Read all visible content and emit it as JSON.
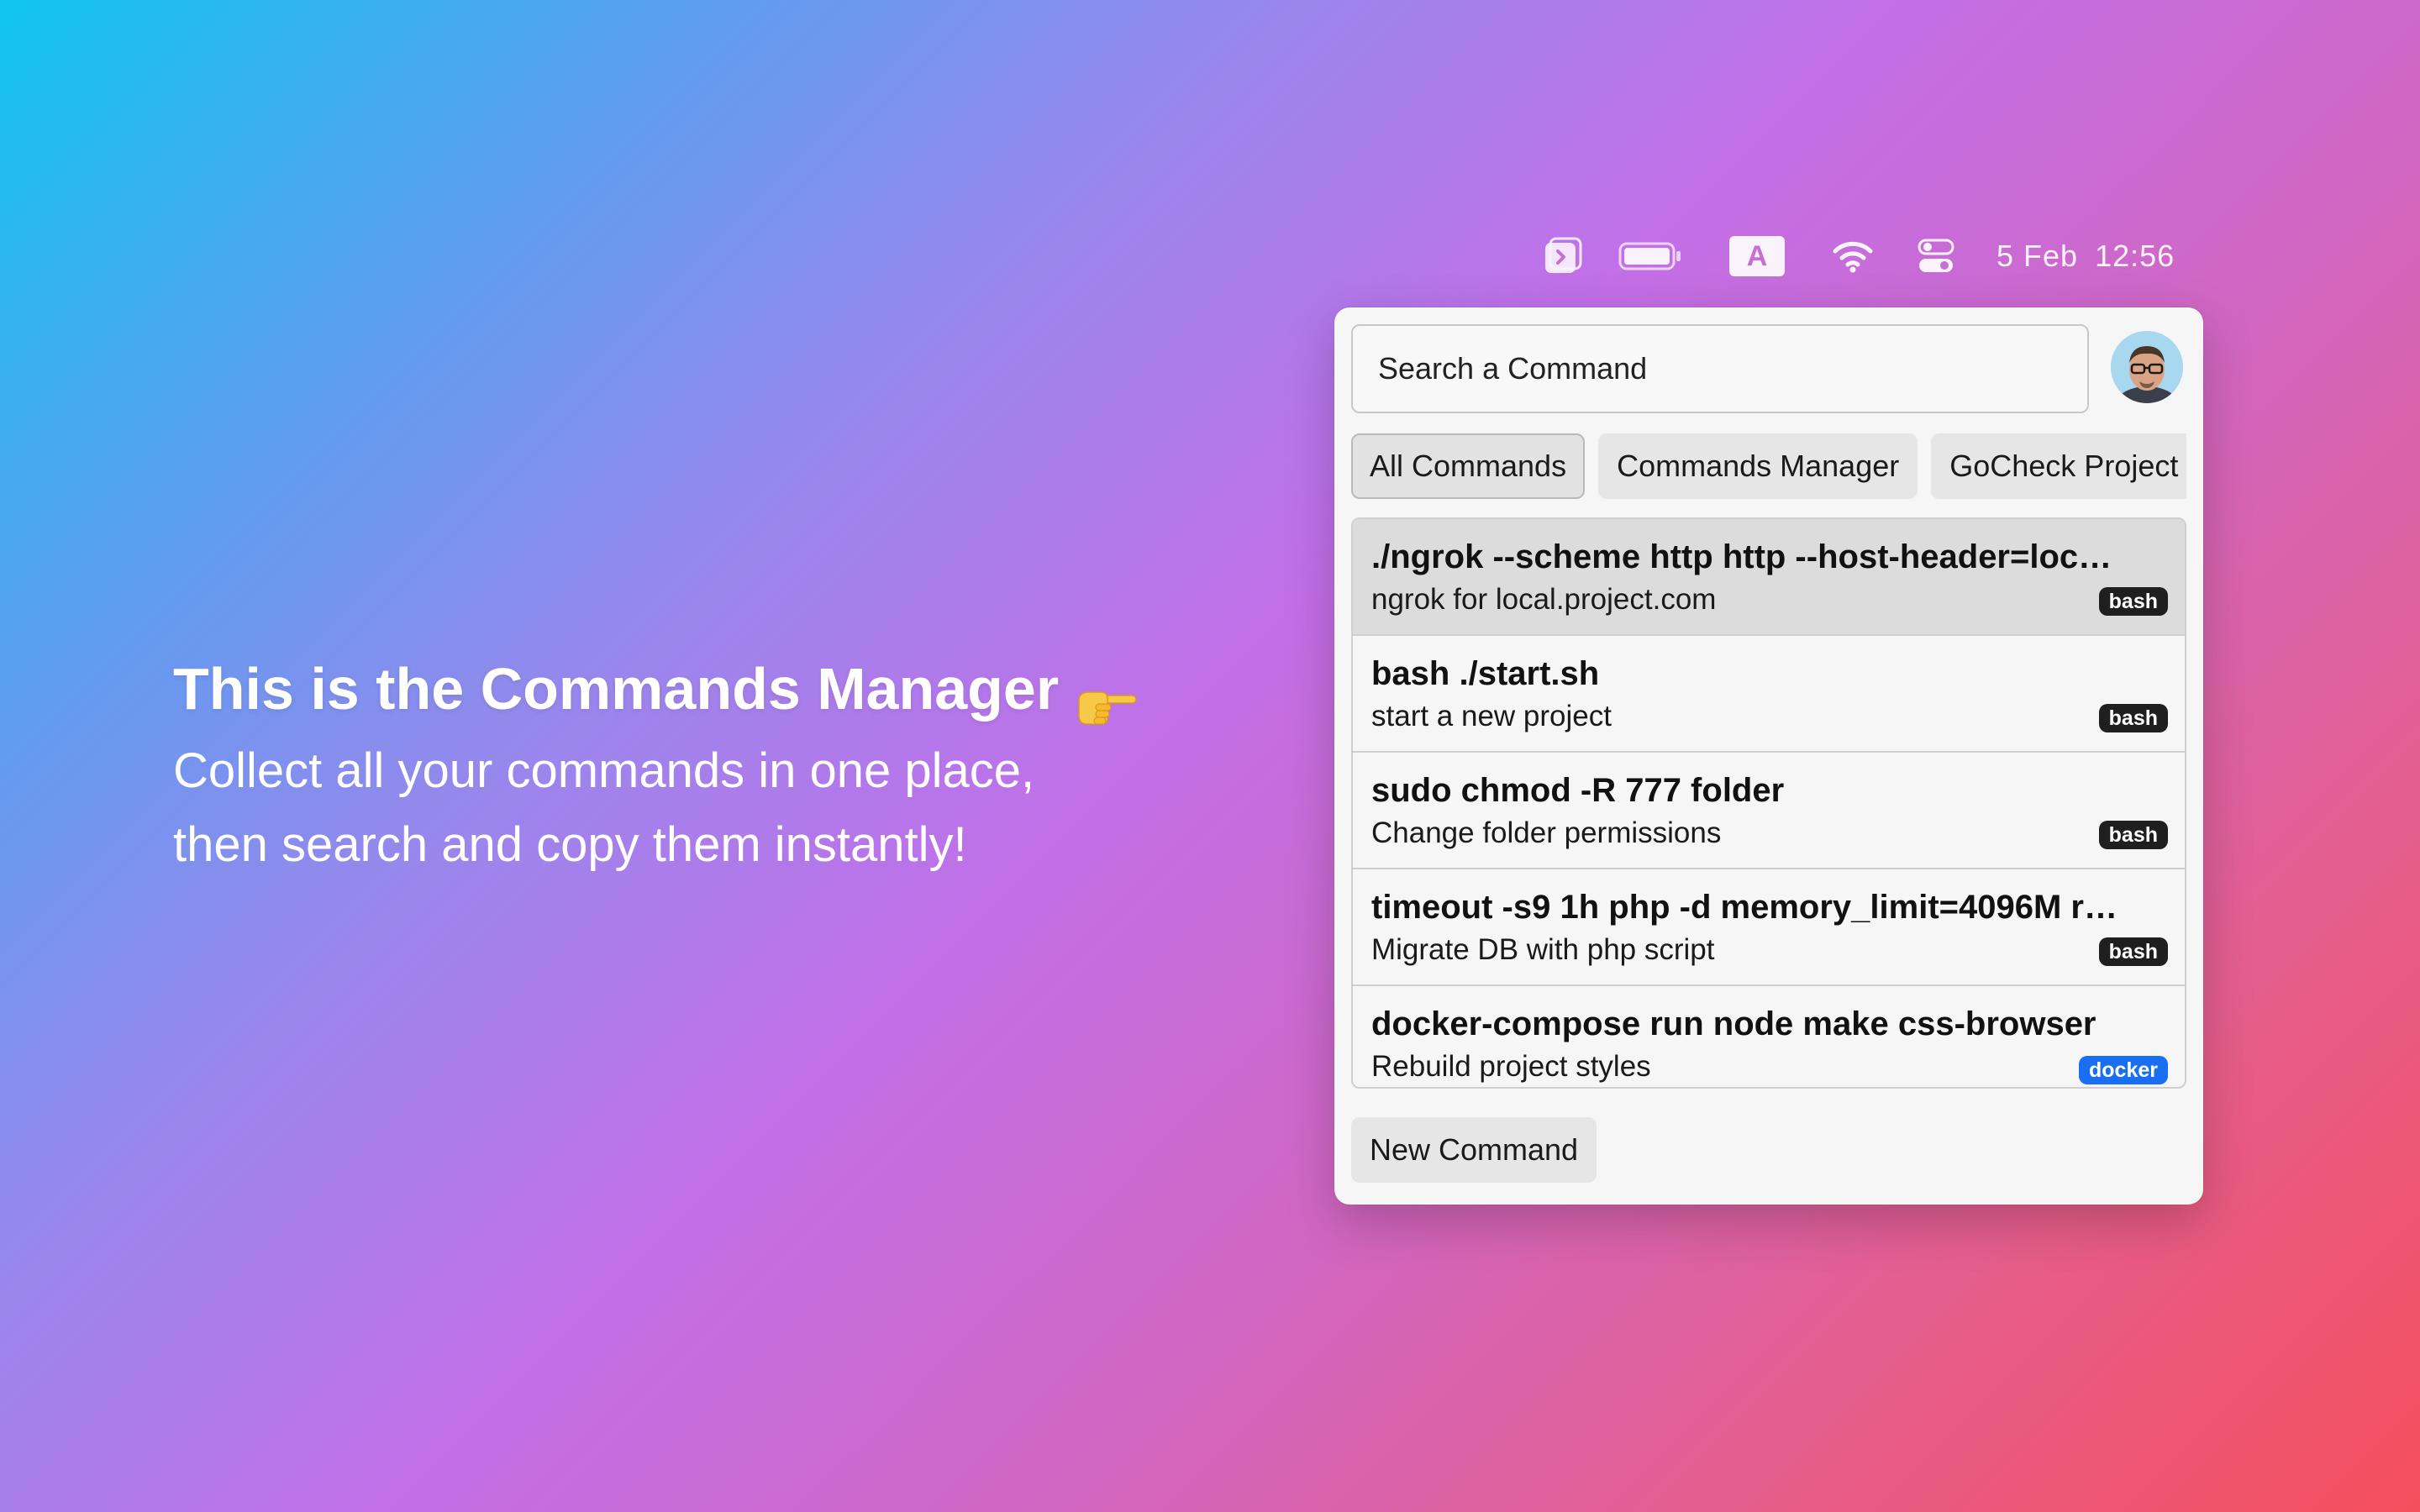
{
  "menubar": {
    "input_source": "A",
    "date": "5 Feb",
    "time": "12:56",
    "icons": [
      "app-terminal-icon",
      "battery-icon",
      "input-source-icon",
      "wifi-icon",
      "control-center-icon"
    ]
  },
  "hero": {
    "title": "This is the Commands Manager",
    "title_icon": "pointing-hand-icon",
    "subtitle_line1": "Collect all your commands in one place,",
    "subtitle_line2": "then search and copy them instantly!"
  },
  "popover": {
    "search": {
      "placeholder": "Search a Command",
      "value": ""
    },
    "avatar": "avatar",
    "tabs": [
      {
        "label": "All Commands",
        "active": true
      },
      {
        "label": "Commands Manager",
        "active": false
      },
      {
        "label": "GoCheck Project",
        "active": false
      }
    ],
    "commands": [
      {
        "command": "./ngrok --scheme http http --host-header=loc…",
        "description": "ngrok for local.project.com",
        "tag": "bash",
        "tag_color": "#1f1f1f",
        "selected": true
      },
      {
        "command": "bash ./start.sh",
        "description": "start a new project",
        "tag": "bash",
        "tag_color": "#1f1f1f",
        "selected": false
      },
      {
        "command": "sudo chmod -R 777 folder",
        "description": "Change folder permissions",
        "tag": "bash",
        "tag_color": "#1f1f1f",
        "selected": false
      },
      {
        "command": "timeout -s9 1h php -d memory_limit=4096M r…",
        "description": "Migrate DB with php script",
        "tag": "bash",
        "tag_color": "#1f1f1f",
        "selected": false
      },
      {
        "command": "docker-compose run node make css-browser",
        "description": "Rebuild project styles",
        "tag": "docker",
        "tag_color": "#1a6ef2",
        "selected": false
      }
    ],
    "new_command_label": "New Command"
  }
}
